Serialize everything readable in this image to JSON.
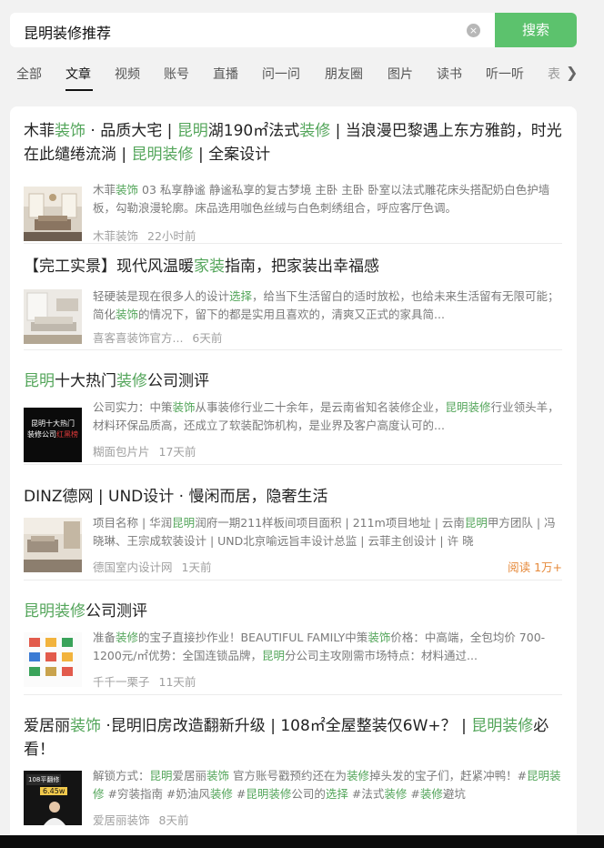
{
  "search": {
    "query": "昆明装修推荐",
    "clear_glyph": "×",
    "button_label": "搜索"
  },
  "tabs": [
    {
      "label": "全部"
    },
    {
      "label": "文章",
      "active": true
    },
    {
      "label": "视频"
    },
    {
      "label": "账号"
    },
    {
      "label": "直播"
    },
    {
      "label": "问一问"
    },
    {
      "label": "朋友圈"
    },
    {
      "label": "图片"
    },
    {
      "label": "读书"
    },
    {
      "label": "听一听"
    },
    {
      "label": "表"
    }
  ],
  "tab_more_icon": "chevron-right-icon",
  "highlight_color": "#53a55a",
  "accent_color": "#5cc26d",
  "results": [
    {
      "title": [
        {
          "t": "木菲"
        },
        {
          "t": "装饰",
          "h": true
        },
        {
          "t": " · 品质大宅 | "
        },
        {
          "t": "昆明",
          "h": true
        },
        {
          "t": "湖190㎡法式"
        },
        {
          "t": "装修",
          "h": true
        },
        {
          "t": " | 当浪漫巴黎遇上东方雅韵，时光在此缱绻流淌 | "
        },
        {
          "t": "昆明装修",
          "h": true
        },
        {
          "t": " | 全案设计"
        }
      ],
      "snippet": [
        {
          "t": "木菲"
        },
        {
          "t": "装饰",
          "h": true
        },
        {
          "t": " 03 私享静谧 静谧私享的复古梦境 主卧 主卧 卧室以法式雕花床头搭配奶白色护墙板，勾勒浪漫轮廓。床品选用咖色丝绒与白色刺绣组合，呼应客厅色调。"
        }
      ],
      "source": "木菲装饰",
      "time": "22小时前"
    },
    {
      "title": [
        {
          "t": "【完工实景】现代风温暖"
        },
        {
          "t": "家装",
          "h": true
        },
        {
          "t": "指南，把家装出幸福感"
        }
      ],
      "snippet": [
        {
          "t": "轻硬装是现在很多人的设计"
        },
        {
          "t": "选择",
          "h": true
        },
        {
          "t": "，给当下生活留白的适时放松，也给未来生活留有无限可能；简化"
        },
        {
          "t": "装饰",
          "h": true
        },
        {
          "t": "的情况下，留下的都是实用且喜欢的，清爽又正式的家具简..."
        }
      ],
      "source": "喜客喜装饰官方...",
      "time": "6天前"
    },
    {
      "title": [
        {
          "t": "昆明",
          "h": true
        },
        {
          "t": "十大热门"
        },
        {
          "t": "装修",
          "h": true
        },
        {
          "t": "公司测评"
        }
      ],
      "thumb_text": [
        "昆明十大热门",
        "装修公司",
        "红黑榜"
      ],
      "snippet": [
        {
          "t": "公司实力：中策"
        },
        {
          "t": "装饰",
          "h": true
        },
        {
          "t": "从事装修行业二十余年，是云南省知名装修企业，"
        },
        {
          "t": "昆明装修",
          "h": true
        },
        {
          "t": "行业领头羊，材料环保品质高，还成立了软装配饰机构，是业界及客户高度认可的..."
        }
      ],
      "source": "糊面包片片",
      "time": "17天前"
    },
    {
      "title": [
        {
          "t": "DINZ德网 | UND设计 · 慢闲而居，隐奢生活"
        }
      ],
      "snippet": [
        {
          "t": "项目名称 | 华润"
        },
        {
          "t": "昆明",
          "h": true
        },
        {
          "t": "润府一期211样板间项目面积 | 211m项目地址 | 云南"
        },
        {
          "t": "昆明",
          "h": true
        },
        {
          "t": "甲方团队 | 冯晓琳、王宗成软装设计 | UND北京喻远旨丰设计总监 | 云菲主创设计 | 许 晓"
        }
      ],
      "source": "德国室内设计网",
      "time": "1天前",
      "read": "阅读 1万+"
    },
    {
      "title": [
        {
          "t": "昆明装修",
          "h": true
        },
        {
          "t": "公司测评"
        }
      ],
      "snippet": [
        {
          "t": "准备"
        },
        {
          "t": "装修",
          "h": true
        },
        {
          "t": "的宝子直接抄作业！BEAUTIFUL FAMILY中策"
        },
        {
          "t": "装饰",
          "h": true
        },
        {
          "t": "价格：中高端，全包均价 700-1200元/㎡优势：全国连锁品牌，"
        },
        {
          "t": "昆明",
          "h": true
        },
        {
          "t": "分公司主攻刚需市场特点：材料通过..."
        }
      ],
      "source": "千千一栗子",
      "time": "11天前"
    },
    {
      "title": [
        {
          "t": "爱居丽"
        },
        {
          "t": "装饰",
          "h": true
        },
        {
          "t": " ·昆明旧房改造翻新升级 | 108㎡全屋整装仅6W+？ | "
        },
        {
          "t": "昆明装修",
          "h": true
        },
        {
          "t": "必看！"
        }
      ],
      "thumb_text": [
        "108平翻修",
        "6.45w"
      ],
      "snippet": [
        {
          "t": "解锁方式："
        },
        {
          "t": "昆明",
          "h": true
        },
        {
          "t": "爱居丽"
        },
        {
          "t": "装饰",
          "h": true
        },
        {
          "t": " 官方账号戳预约还在为"
        },
        {
          "t": "装修",
          "h": true
        },
        {
          "t": "掉头发的宝子们，赶紧冲鸭！#"
        },
        {
          "t": "昆明装修",
          "h": true
        },
        {
          "t": " #穷装指南 #奶油风"
        },
        {
          "t": "装修",
          "h": true
        },
        {
          "t": " #"
        },
        {
          "t": "昆明装修",
          "h": true
        },
        {
          "t": "公司的"
        },
        {
          "t": "选择",
          "h": true
        },
        {
          "t": " #法式"
        },
        {
          "t": "装修",
          "h": true
        },
        {
          "t": " #"
        },
        {
          "t": "装修",
          "h": true
        },
        {
          "t": "避坑"
        }
      ],
      "source": "爱居丽装饰",
      "time": "8天前"
    }
  ]
}
